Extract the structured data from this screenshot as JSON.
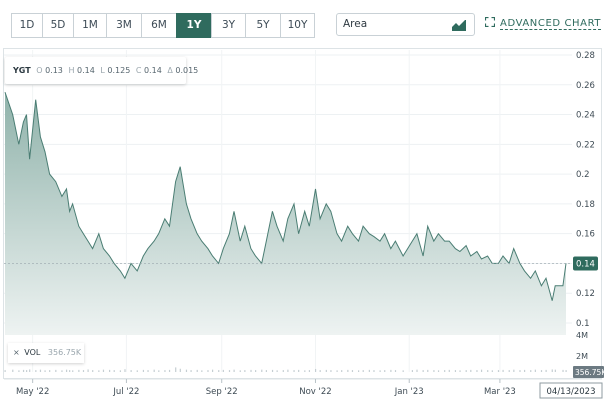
{
  "toolbar": {
    "ranges": [
      "1D",
      "5D",
      "1M",
      "3M",
      "6M",
      "1Y",
      "3Y",
      "5Y",
      "10Y"
    ],
    "active_range": "1Y",
    "chart_type": "Area",
    "advanced_label": "ADVANCED CHART"
  },
  "ohlc": {
    "symbol": "YGT",
    "open_label": "O",
    "open": "0.13",
    "high_label": "H",
    "high": "0.14",
    "low_label": "L",
    "low": "0.125",
    "close_label": "C",
    "close": "0.14",
    "change_label": "Δ",
    "change": "0.015"
  },
  "volume": {
    "close_icon": "×",
    "label": "VOL",
    "value": "356.75K",
    "axis_labels": [
      "4M",
      "2M"
    ],
    "last_value_tag": "356.75K"
  },
  "colors": {
    "accent": "#2f6b5e",
    "line": "#4a7d73",
    "fill_top": "#8fb2aa",
    "fill_bottom": "#eef3f2",
    "price_tag": "#2f6b5e",
    "volume_tag": "#6c7a82"
  },
  "chart_data": {
    "type": "area",
    "x_tick_labels": [
      "May '22",
      "Jul '22",
      "Sep '22",
      "Nov '22",
      "Jan '23",
      "Mar '23"
    ],
    "current_date_tag": "04/13/2023",
    "y_ticks": [
      "0.28",
      "0.26",
      "0.24",
      "0.22",
      "0.2",
      "0.18",
      "0.16",
      "0.14",
      "0.12",
      "0.1"
    ],
    "ylim": [
      0.1,
      0.28
    ],
    "last_price_tag": "0.14",
    "last_price": 0.14,
    "x": [
      "2022-04-13",
      "2022-04-18",
      "2022-04-22",
      "2022-04-25",
      "2022-04-27",
      "2022-04-29",
      "2022-05-03",
      "2022-05-06",
      "2022-05-09",
      "2022-05-12",
      "2022-05-16",
      "2022-05-20",
      "2022-05-23",
      "2022-05-25",
      "2022-05-27",
      "2022-05-31",
      "2022-06-03",
      "2022-06-06",
      "2022-06-09",
      "2022-06-13",
      "2022-06-16",
      "2022-06-20",
      "2022-06-23",
      "2022-06-27",
      "2022-06-30",
      "2022-07-04",
      "2022-07-08",
      "2022-07-12",
      "2022-07-15",
      "2022-07-19",
      "2022-07-22",
      "2022-07-26",
      "2022-07-29",
      "2022-08-02",
      "2022-08-05",
      "2022-08-09",
      "2022-08-12",
      "2022-08-16",
      "2022-08-19",
      "2022-08-23",
      "2022-08-26",
      "2022-08-30",
      "2022-09-02",
      "2022-09-06",
      "2022-09-09",
      "2022-09-13",
      "2022-09-16",
      "2022-09-20",
      "2022-09-23",
      "2022-09-27",
      "2022-09-30",
      "2022-10-04",
      "2022-10-07",
      "2022-10-11",
      "2022-10-14",
      "2022-10-18",
      "2022-10-21",
      "2022-10-25",
      "2022-10-28",
      "2022-11-01",
      "2022-11-04",
      "2022-11-08",
      "2022-11-11",
      "2022-11-15",
      "2022-11-18",
      "2022-11-22",
      "2022-11-25",
      "2022-11-29",
      "2022-12-02",
      "2022-12-06",
      "2022-12-09",
      "2022-12-13",
      "2022-12-16",
      "2022-12-20",
      "2022-12-23",
      "2022-12-28",
      "2023-01-03",
      "2023-01-06",
      "2023-01-10",
      "2023-01-13",
      "2023-01-17",
      "2023-01-20",
      "2023-01-24",
      "2023-01-27",
      "2023-01-31",
      "2023-02-03",
      "2023-02-07",
      "2023-02-10",
      "2023-02-14",
      "2023-02-17",
      "2023-02-21",
      "2023-02-24",
      "2023-02-28",
      "2023-03-03",
      "2023-03-07",
      "2023-03-10",
      "2023-03-14",
      "2023-03-17",
      "2023-03-21",
      "2023-03-24",
      "2023-03-28",
      "2023-03-31",
      "2023-04-04",
      "2023-04-06",
      "2023-04-11",
      "2023-04-13"
    ],
    "values": [
      0.255,
      0.24,
      0.22,
      0.235,
      0.24,
      0.21,
      0.25,
      0.225,
      0.215,
      0.2,
      0.195,
      0.185,
      0.19,
      0.175,
      0.18,
      0.165,
      0.16,
      0.155,
      0.15,
      0.16,
      0.15,
      0.145,
      0.14,
      0.135,
      0.13,
      0.14,
      0.135,
      0.145,
      0.15,
      0.155,
      0.16,
      0.17,
      0.165,
      0.195,
      0.205,
      0.18,
      0.17,
      0.16,
      0.155,
      0.15,
      0.145,
      0.14,
      0.15,
      0.16,
      0.175,
      0.155,
      0.165,
      0.15,
      0.145,
      0.14,
      0.155,
      0.175,
      0.165,
      0.155,
      0.17,
      0.18,
      0.16,
      0.175,
      0.165,
      0.19,
      0.17,
      0.18,
      0.175,
      0.16,
      0.155,
      0.165,
      0.16,
      0.155,
      0.165,
      0.16,
      0.158,
      0.155,
      0.16,
      0.15,
      0.155,
      0.145,
      0.155,
      0.16,
      0.145,
      0.165,
      0.155,
      0.16,
      0.155,
      0.155,
      0.15,
      0.148,
      0.152,
      0.145,
      0.148,
      0.143,
      0.145,
      0.14,
      0.14,
      0.145,
      0.14,
      0.15,
      0.14,
      0.135,
      0.13,
      0.135,
      0.125,
      0.13,
      0.115,
      0.125,
      0.125,
      0.14
    ],
    "volume": [
      0.2,
      0.3,
      0.15,
      0.25,
      0.2,
      0.35,
      0.2,
      0.3,
      0.15,
      0.2,
      0.25,
      0.15,
      0.3,
      0.2,
      0.15,
      0.25,
      0.2,
      0.35,
      0.2,
      0.15,
      0.3,
      0.25,
      0.2,
      0.15,
      0.4,
      0.2,
      0.15,
      0.25,
      0.2,
      0.3,
      0.15,
      0.2,
      0.25,
      0.8,
      0.5,
      0.3,
      0.2,
      0.25,
      0.15,
      0.2,
      0.3,
      0.2,
      0.25,
      0.2,
      0.3,
      0.15,
      0.2,
      0.25,
      0.2,
      0.3,
      0.2,
      0.25,
      0.15,
      0.2,
      0.3,
      0.2,
      0.25,
      0.15,
      0.2,
      0.45,
      0.2,
      0.25,
      0.2,
      0.15,
      0.2,
      0.25,
      0.2,
      0.15,
      0.2,
      0.25,
      0.2,
      0.15,
      0.2,
      0.25,
      0.2,
      0.15,
      0.2,
      0.3,
      0.2,
      0.25,
      0.2,
      0.15,
      0.2,
      0.25,
      0.2,
      0.15,
      0.2,
      0.25,
      0.2,
      0.3,
      0.2,
      0.15,
      0.2,
      0.25,
      0.2,
      0.3,
      0.2,
      0.25,
      0.2,
      0.3,
      0.2,
      0.25,
      0.35,
      0.3,
      0.25,
      0.2
    ]
  }
}
